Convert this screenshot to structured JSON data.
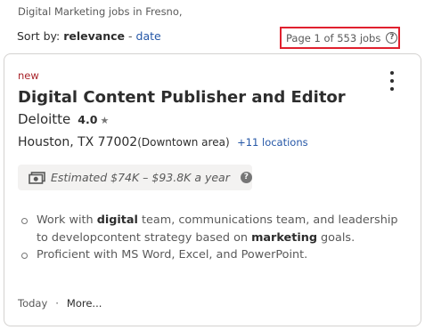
{
  "heading": "Digital Marketing jobs in Fresno,",
  "sort": {
    "label": "Sort by:",
    "active": "relevance",
    "separator": "-",
    "other": "date"
  },
  "pagination": {
    "text": "Page 1 of 553 jobs",
    "help_icon": "question-circle-icon"
  },
  "job": {
    "badge": "new",
    "title": "Digital Content Publisher and Editor",
    "company": "Deloitte",
    "rating": "4.0",
    "rating_icon": "star-icon",
    "location": "Houston, TX 77002",
    "area": "(Downtown area)",
    "more_locations": "+11 locations",
    "salary": "Estimated $74K – $93.8K a year",
    "salary_icon": "money-icon",
    "salary_info_icon": "info-icon",
    "snippet": [
      {
        "parts": [
          {
            "text": "Work with ",
            "bold": false
          },
          {
            "text": "digital",
            "bold": true
          },
          {
            "text": " team, communications team, and leadership to developcontent strategy based on ",
            "bold": false
          },
          {
            "text": "marketing",
            "bold": true
          },
          {
            "text": " goals.",
            "bold": false
          }
        ]
      },
      {
        "parts": [
          {
            "text": "Proficient with MS Word, Excel, and PowerPoint.",
            "bold": false
          }
        ]
      }
    ],
    "posted": "Today",
    "footer_sep": "·",
    "more_label": "More..."
  },
  "colors": {
    "highlight_border": "#e0202e",
    "link": "#2557a7",
    "new_badge": "#a9252b"
  }
}
